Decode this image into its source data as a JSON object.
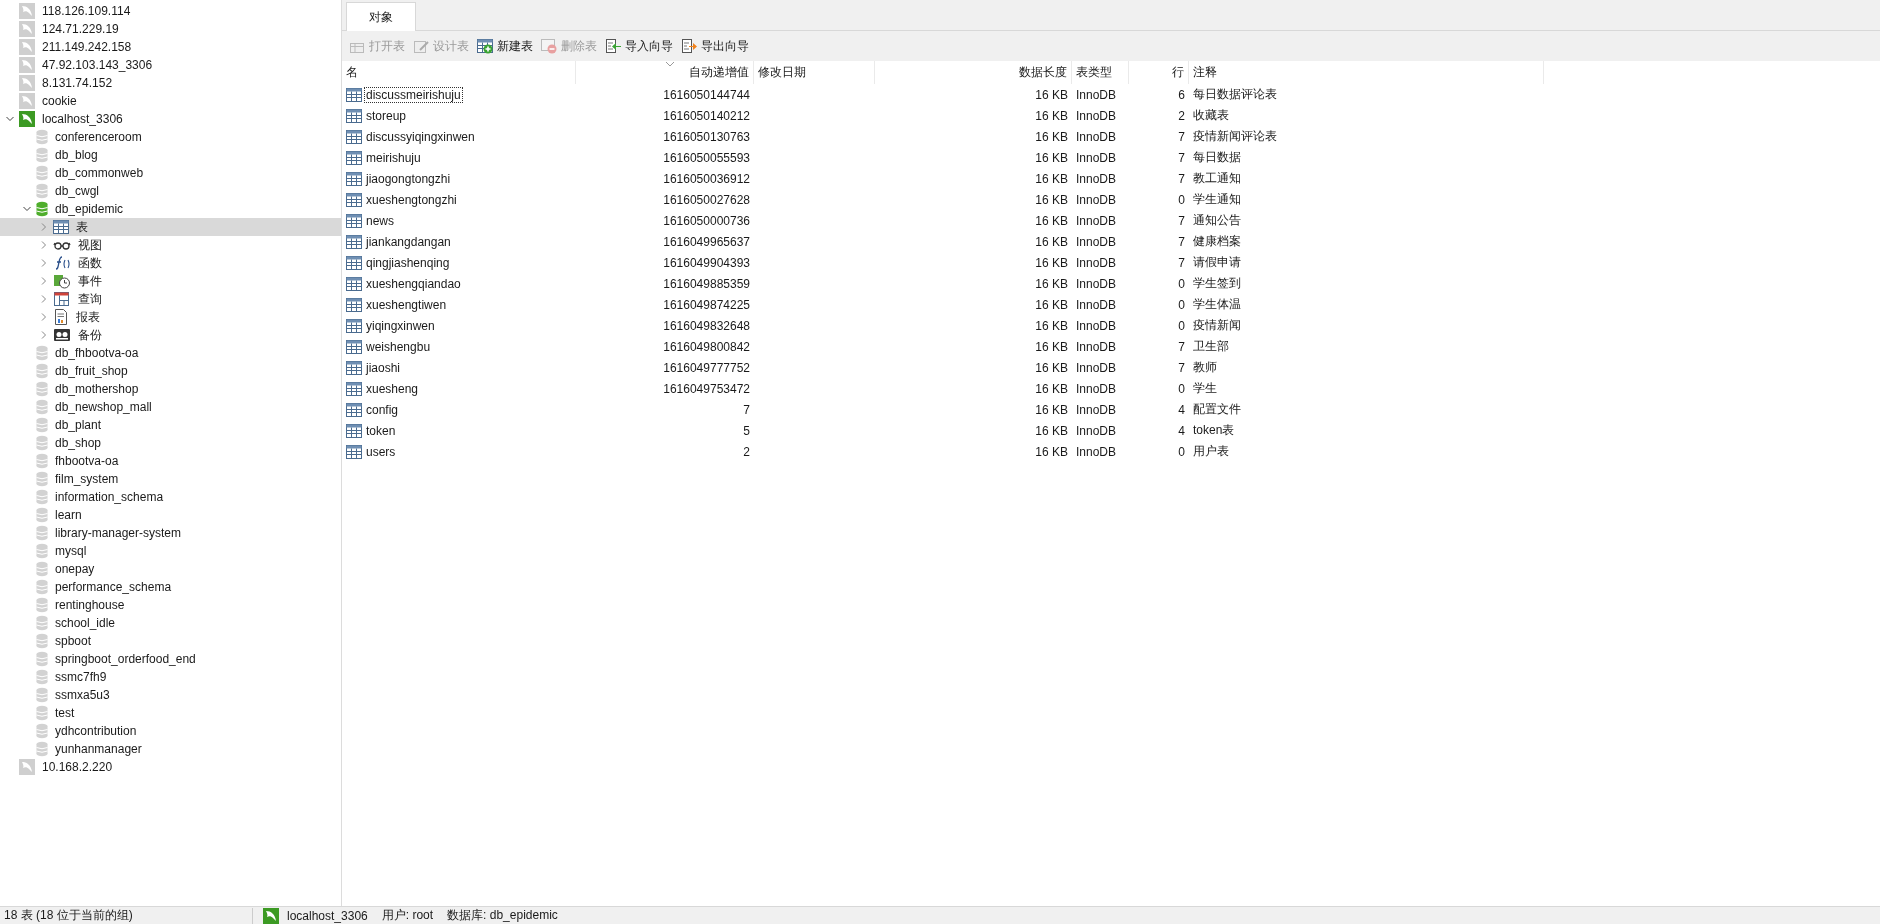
{
  "sidebar": {
    "items": [
      {
        "kind": "connection",
        "label": "118.126.109.114",
        "open": false
      },
      {
        "kind": "connection",
        "label": "124.71.229.19",
        "open": false
      },
      {
        "kind": "connection",
        "label": "211.149.242.158",
        "open": false
      },
      {
        "kind": "connection",
        "label": "47.92.103.143_3306",
        "open": false
      },
      {
        "kind": "connection",
        "label": "8.131.74.152",
        "open": false
      },
      {
        "kind": "connection",
        "label": "cookie",
        "open": false
      },
      {
        "kind": "connection",
        "label": "localhost_3306",
        "open": true,
        "expanded": true,
        "children": [
          {
            "kind": "database",
            "label": "conferenceroom",
            "open": false
          },
          {
            "kind": "database",
            "label": "db_blog",
            "open": false
          },
          {
            "kind": "database",
            "label": "db_commonweb",
            "open": false
          },
          {
            "kind": "database",
            "label": "db_cwgl",
            "open": false
          },
          {
            "kind": "database",
            "label": "db_epidemic",
            "open": true,
            "expanded": true,
            "children": [
              {
                "kind": "tables",
                "label": "表",
                "expanded": false,
                "selected": true
              },
              {
                "kind": "views",
                "label": "视图",
                "expanded": false,
                "selected": false
              },
              {
                "kind": "functions",
                "label": "函数",
                "expanded": false,
                "selected": false
              },
              {
                "kind": "events",
                "label": "事件",
                "expanded": false,
                "selected": false
              },
              {
                "kind": "queries",
                "label": "查询",
                "expanded": false,
                "selected": false
              },
              {
                "kind": "reports",
                "label": "报表",
                "expanded": false,
                "selected": false
              },
              {
                "kind": "backups",
                "label": "备份",
                "expanded": false,
                "selected": false
              }
            ]
          },
          {
            "kind": "database",
            "label": "db_fhbootva-oa",
            "open": false
          },
          {
            "kind": "database",
            "label": "db_fruit_shop",
            "open": false
          },
          {
            "kind": "database",
            "label": "db_mothershop",
            "open": false
          },
          {
            "kind": "database",
            "label": "db_newshop_mall",
            "open": false
          },
          {
            "kind": "database",
            "label": "db_plant",
            "open": false
          },
          {
            "kind": "database",
            "label": "db_shop",
            "open": false
          },
          {
            "kind": "database",
            "label": "fhbootva-oa",
            "open": false
          },
          {
            "kind": "database",
            "label": "film_system",
            "open": false
          },
          {
            "kind": "database",
            "label": "information_schema",
            "open": false
          },
          {
            "kind": "database",
            "label": "learn",
            "open": false
          },
          {
            "kind": "database",
            "label": "library-manager-system",
            "open": false
          },
          {
            "kind": "database",
            "label": "mysql",
            "open": false
          },
          {
            "kind": "database",
            "label": "onepay",
            "open": false
          },
          {
            "kind": "database",
            "label": "performance_schema",
            "open": false
          },
          {
            "kind": "database",
            "label": "rentinghouse",
            "open": false
          },
          {
            "kind": "database",
            "label": "school_idle",
            "open": false
          },
          {
            "kind": "database",
            "label": "spboot",
            "open": false
          },
          {
            "kind": "database",
            "label": "springboot_orderfood_end",
            "open": false
          },
          {
            "kind": "database",
            "label": "ssmc7fh9",
            "open": false
          },
          {
            "kind": "database",
            "label": "ssmxa5u3",
            "open": false
          },
          {
            "kind": "database",
            "label": "test",
            "open": false
          },
          {
            "kind": "database",
            "label": "ydhcontribution",
            "open": false
          },
          {
            "kind": "database",
            "label": "yunhanmanager",
            "open": false
          }
        ]
      },
      {
        "kind": "connection",
        "label": "10.168.2.220",
        "open": false
      }
    ]
  },
  "tabs": [
    {
      "label": "对象",
      "selected": true
    }
  ],
  "toolbar": [
    {
      "kind": "open-table",
      "label": "打开表",
      "disabled": true
    },
    {
      "kind": "design-table",
      "label": "设计表",
      "disabled": true
    },
    {
      "kind": "new-table",
      "label": "新建表",
      "disabled": false
    },
    {
      "kind": "delete-table",
      "label": "删除表",
      "disabled": true
    },
    {
      "kind": "import",
      "label": "导入向导",
      "disabled": false
    },
    {
      "kind": "export",
      "label": "导出向导",
      "disabled": false
    }
  ],
  "table": {
    "columns": [
      {
        "label": "名",
        "sorted": false
      },
      {
        "label": "自动递增值",
        "sorted": true
      },
      {
        "label": "修改日期",
        "sorted": false
      },
      {
        "label": "数据长度",
        "sorted": false
      },
      {
        "label": "表类型",
        "sorted": false
      },
      {
        "label": "行",
        "sorted": false
      },
      {
        "label": "注释",
        "sorted": false
      }
    ],
    "rows": [
      {
        "name": "discussmeirishuju",
        "auto_increment": "1616050144744",
        "data_length": "16 KB",
        "engine": "InnoDB",
        "rows": "6",
        "comment": "每日数据评论表",
        "focused": true
      },
      {
        "name": "storeup",
        "auto_increment": "1616050140212",
        "data_length": "16 KB",
        "engine": "InnoDB",
        "rows": "2",
        "comment": "收藏表",
        "focused": false
      },
      {
        "name": "discussyiqingxinwen",
        "auto_increment": "1616050130763",
        "data_length": "16 KB",
        "engine": "InnoDB",
        "rows": "7",
        "comment": "疫情新闻评论表",
        "focused": false
      },
      {
        "name": "meirishuju",
        "auto_increment": "1616050055593",
        "data_length": "16 KB",
        "engine": "InnoDB",
        "rows": "7",
        "comment": "每日数据",
        "focused": false
      },
      {
        "name": "jiaogongtongzhi",
        "auto_increment": "1616050036912",
        "data_length": "16 KB",
        "engine": "InnoDB",
        "rows": "7",
        "comment": "教工通知",
        "focused": false
      },
      {
        "name": "xueshengtongzhi",
        "auto_increment": "1616050027628",
        "data_length": "16 KB",
        "engine": "InnoDB",
        "rows": "0",
        "comment": "学生通知",
        "focused": false
      },
      {
        "name": "news",
        "auto_increment": "1616050000736",
        "data_length": "16 KB",
        "engine": "InnoDB",
        "rows": "7",
        "comment": "通知公告",
        "focused": false
      },
      {
        "name": "jiankangdangan",
        "auto_increment": "1616049965637",
        "data_length": "16 KB",
        "engine": "InnoDB",
        "rows": "7",
        "comment": "健康档案",
        "focused": false
      },
      {
        "name": "qingjiashenqing",
        "auto_increment": "1616049904393",
        "data_length": "16 KB",
        "engine": "InnoDB",
        "rows": "7",
        "comment": "请假申请",
        "focused": false
      },
      {
        "name": "xueshengqiandao",
        "auto_increment": "1616049885359",
        "data_length": "16 KB",
        "engine": "InnoDB",
        "rows": "0",
        "comment": "学生签到",
        "focused": false
      },
      {
        "name": "xueshengtiwen",
        "auto_increment": "1616049874225",
        "data_length": "16 KB",
        "engine": "InnoDB",
        "rows": "0",
        "comment": "学生体温",
        "focused": false
      },
      {
        "name": "yiqingxinwen",
        "auto_increment": "1616049832648",
        "data_length": "16 KB",
        "engine": "InnoDB",
        "rows": "0",
        "comment": "疫情新闻",
        "focused": false
      },
      {
        "name": "weishengbu",
        "auto_increment": "1616049800842",
        "data_length": "16 KB",
        "engine": "InnoDB",
        "rows": "7",
        "comment": "卫生部",
        "focused": false
      },
      {
        "name": "jiaoshi",
        "auto_increment": "1616049777752",
        "data_length": "16 KB",
        "engine": "InnoDB",
        "rows": "7",
        "comment": "教师",
        "focused": false
      },
      {
        "name": "xuesheng",
        "auto_increment": "1616049753472",
        "data_length": "16 KB",
        "engine": "InnoDB",
        "rows": "0",
        "comment": "学生",
        "focused": false
      },
      {
        "name": "config",
        "auto_increment": "7",
        "data_length": "16 KB",
        "engine": "InnoDB",
        "rows": "4",
        "comment": "配置文件",
        "focused": false
      },
      {
        "name": "token",
        "auto_increment": "5",
        "data_length": "16 KB",
        "engine": "InnoDB",
        "rows": "4",
        "comment": "token表",
        "focused": false
      },
      {
        "name": "users",
        "auto_increment": "2",
        "data_length": "16 KB",
        "engine": "InnoDB",
        "rows": "0",
        "comment": "用户表",
        "focused": false
      }
    ]
  },
  "status_bar": {
    "summary": "18 表 (18 位于当前的组)",
    "connection": "localhost_3306",
    "user": "用户: root",
    "database": "数据库: db_epidemic"
  }
}
